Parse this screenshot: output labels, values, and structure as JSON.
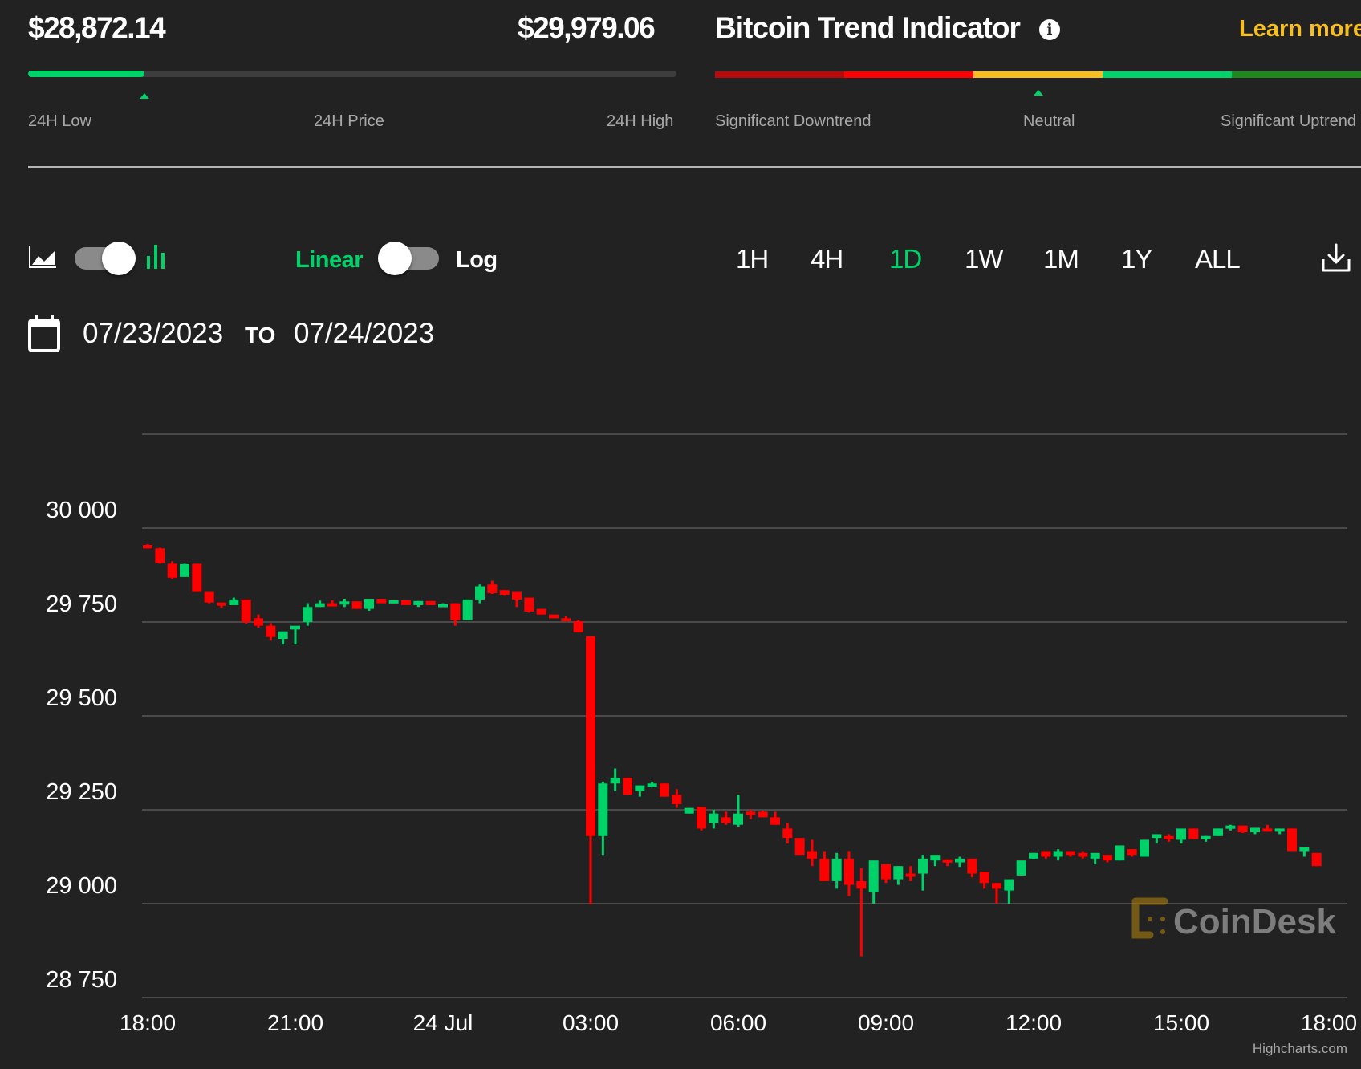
{
  "header": {
    "low_price": "$28,872.14",
    "high_price": "$29,979.06",
    "range_labels": {
      "low": "24H Low",
      "price": "24H Price",
      "high": "24H High"
    },
    "price_position_fraction": 0.18,
    "trend": {
      "title": "Bitcoin Trend Indicator",
      "info_icon": "info-icon",
      "learn_more": "Learn more",
      "segments": [
        "#b80a0a",
        "#ff0000",
        "#f7be22",
        "#00d26a",
        "#1e8a1e"
      ],
      "current": "Neutral",
      "position_fraction": 0.5,
      "labels": {
        "left": "Significant Downtrend",
        "middle": "Neutral",
        "right": "Significant Uptrend"
      }
    }
  },
  "controls": {
    "chart_type_toggle": {
      "left_icon": "area-chart-icon",
      "right_icon": "candlestick-chart-icon",
      "selected": "candlestick"
    },
    "scale_toggle": {
      "left_label": "Linear",
      "right_label": "Log",
      "selected": "Linear"
    },
    "ranges": [
      {
        "label": "1H",
        "active": false
      },
      {
        "label": "4H",
        "active": false
      },
      {
        "label": "1D",
        "active": true
      },
      {
        "label": "1W",
        "active": false
      },
      {
        "label": "1M",
        "active": false
      },
      {
        "label": "1Y",
        "active": false
      },
      {
        "label": "ALL",
        "active": false
      }
    ],
    "download_icon": "download-icon",
    "date_from": "07/23/2023",
    "date_to_label": "TO",
    "date_to": "07/24/2023"
  },
  "colors": {
    "up": "#00d26a",
    "down": "#ff0000",
    "accent": "#00d26a",
    "learn_more": "#f7be22",
    "background": "#222222"
  },
  "chart_data": {
    "type": "candlestick",
    "title": "",
    "xlabel": "",
    "ylabel": "",
    "ylim": [
      28750,
      30250
    ],
    "yticks": [
      28750,
      29000,
      29250,
      29500,
      29750,
      30000
    ],
    "ytick_labels": [
      "28 750",
      "29 000",
      "29 250",
      "29 500",
      "29 750",
      "30 000"
    ],
    "xticks": [
      "18:00",
      "21:00",
      "24 Jul",
      "03:00",
      "06:00",
      "09:00",
      "12:00",
      "15:00",
      "18:00"
    ],
    "interval_minutes": 15,
    "grid": true,
    "watermark": "CoinDesk",
    "credit": "Highcharts.com",
    "ohlc": [
      [
        29955,
        29957,
        29946,
        29946
      ],
      [
        29946,
        29948,
        29905,
        29907
      ],
      [
        29905,
        29912,
        29865,
        29868
      ],
      [
        29870,
        29905,
        29870,
        29904
      ],
      [
        29905,
        29905,
        29830,
        29830
      ],
      [
        29830,
        29830,
        29800,
        29802
      ],
      [
        29802,
        29800,
        29788,
        29795
      ],
      [
        29795,
        29815,
        29795,
        29810
      ],
      [
        29810,
        29810,
        29745,
        29750
      ],
      [
        29760,
        29770,
        29735,
        29740
      ],
      [
        29740,
        29747,
        29700,
        29710
      ],
      [
        29705,
        29705,
        29690,
        29725
      ],
      [
        29730,
        29735,
        29690,
        29740
      ],
      [
        29750,
        29800,
        29740,
        29790
      ],
      [
        29790,
        29807,
        29790,
        29800
      ],
      [
        29800,
        29808,
        29795,
        29795
      ],
      [
        29798,
        29812,
        29790,
        29805
      ],
      [
        29805,
        29805,
        29785,
        29785
      ],
      [
        29785,
        29812,
        29780,
        29812
      ],
      [
        29812,
        29812,
        29800,
        29800
      ],
      [
        29800,
        29808,
        29800,
        29808
      ],
      [
        29808,
        29808,
        29795,
        29795
      ],
      [
        29795,
        29806,
        29790,
        29806
      ],
      [
        29806,
        29806,
        29795,
        29795
      ],
      [
        29790,
        29800,
        29790,
        29798
      ],
      [
        29800,
        29800,
        29740,
        29755
      ],
      [
        29755,
        29810,
        29755,
        29810
      ],
      [
        29810,
        29850,
        29800,
        29845
      ],
      [
        29850,
        29860,
        29825,
        29827
      ],
      [
        29835,
        29835,
        29820,
        29822
      ],
      [
        29830,
        29830,
        29790,
        29810
      ],
      [
        29815,
        29815,
        29775,
        29778
      ],
      [
        29785,
        29785,
        29770,
        29770
      ],
      [
        29770,
        29770,
        29760,
        29760
      ],
      [
        29760,
        29765,
        29752,
        29752
      ],
      [
        29752,
        29755,
        29722,
        29722
      ],
      [
        29712,
        29712,
        28998,
        29180
      ],
      [
        29180,
        29325,
        29130,
        29320
      ],
      [
        29320,
        29360,
        29300,
        29335
      ],
      [
        29335,
        29335,
        29290,
        29290
      ],
      [
        29300,
        29315,
        29285,
        29315
      ],
      [
        29320,
        29325,
        29310,
        29320
      ],
      [
        29320,
        29320,
        29285,
        29285
      ],
      [
        29290,
        29305,
        29255,
        29265
      ],
      [
        29240,
        29255,
        29240,
        29255
      ],
      [
        29258,
        29258,
        29195,
        29200
      ],
      [
        29215,
        29250,
        29200,
        29240
      ],
      [
        29230,
        29245,
        29210,
        29215
      ],
      [
        29210,
        29290,
        29205,
        29240
      ],
      [
        29245,
        29250,
        29225,
        29240
      ],
      [
        29245,
        29248,
        29230,
        29230
      ],
      [
        29230,
        29245,
        29210,
        29210
      ],
      [
        29200,
        29215,
        29160,
        29175
      ],
      [
        29175,
        29175,
        29130,
        29130
      ],
      [
        29140,
        29170,
        29100,
        29120
      ],
      [
        29120,
        29140,
        29060,
        29060
      ],
      [
        29060,
        29135,
        29040,
        29120
      ],
      [
        29120,
        29140,
        29020,
        29050
      ],
      [
        29060,
        29095,
        28860,
        29040
      ],
      [
        29030,
        29110,
        29000,
        29115
      ],
      [
        29105,
        29105,
        29055,
        29065
      ],
      [
        29065,
        29100,
        29050,
        29100
      ],
      [
        29080,
        29100,
        29060,
        29075
      ],
      [
        29080,
        29130,
        29035,
        29120
      ],
      [
        29115,
        29127,
        29100,
        29130
      ],
      [
        29118,
        29118,
        29100,
        29110
      ],
      [
        29110,
        29125,
        29098,
        29120
      ],
      [
        29120,
        29120,
        29070,
        29080
      ],
      [
        29085,
        29085,
        29040,
        29055
      ],
      [
        29055,
        29055,
        29000,
        29040
      ],
      [
        29035,
        29055,
        29000,
        29065
      ],
      [
        29075,
        29105,
        29075,
        29115
      ],
      [
        29120,
        29135,
        29120,
        29135
      ],
      [
        29140,
        29140,
        29120,
        29125
      ],
      [
        29125,
        29145,
        29115,
        29140
      ],
      [
        29140,
        29140,
        29125,
        29130
      ],
      [
        29135,
        29140,
        29120,
        29125
      ],
      [
        29120,
        29125,
        29105,
        29135
      ],
      [
        29130,
        29130,
        29110,
        29115
      ],
      [
        29115,
        29155,
        29115,
        29155
      ],
      [
        29145,
        29145,
        29125,
        29130
      ],
      [
        29125,
        29170,
        29125,
        29170
      ],
      [
        29175,
        29178,
        29160,
        29185
      ],
      [
        29180,
        29185,
        29165,
        29172
      ],
      [
        29170,
        29170,
        29160,
        29200
      ],
      [
        29200,
        29200,
        29180,
        29172
      ],
      [
        29172,
        29180,
        29165,
        29180
      ],
      [
        29180,
        29200,
        29180,
        29200
      ],
      [
        29205,
        29210,
        29195,
        29208
      ],
      [
        29208,
        29208,
        29188,
        29190
      ],
      [
        29190,
        29200,
        29185,
        29202
      ],
      [
        29200,
        29210,
        29192,
        29195
      ],
      [
        29195,
        29200,
        29185,
        29200
      ],
      [
        29200,
        29200,
        29140,
        29140
      ],
      [
        29140,
        29150,
        29125,
        29150
      ],
      [
        29135,
        29135,
        29100,
        29100
      ]
    ]
  }
}
